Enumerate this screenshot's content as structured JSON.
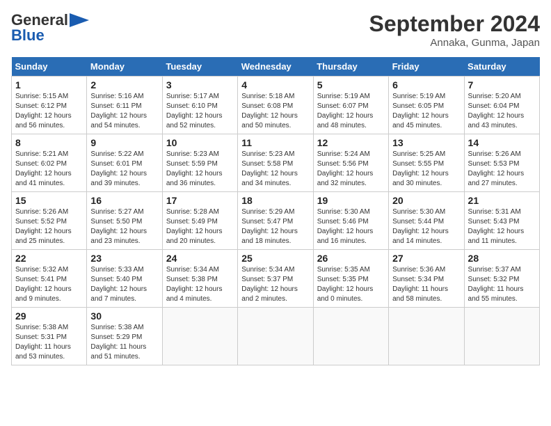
{
  "header": {
    "logo_line1": "General",
    "logo_line2": "Blue",
    "month_title": "September 2024",
    "location": "Annaka, Gunma, Japan"
  },
  "days_of_week": [
    "Sunday",
    "Monday",
    "Tuesday",
    "Wednesday",
    "Thursday",
    "Friday",
    "Saturday"
  ],
  "weeks": [
    [
      {
        "day": "1",
        "info": "Sunrise: 5:15 AM\nSunset: 6:12 PM\nDaylight: 12 hours\nand 56 minutes."
      },
      {
        "day": "2",
        "info": "Sunrise: 5:16 AM\nSunset: 6:11 PM\nDaylight: 12 hours\nand 54 minutes."
      },
      {
        "day": "3",
        "info": "Sunrise: 5:17 AM\nSunset: 6:10 PM\nDaylight: 12 hours\nand 52 minutes."
      },
      {
        "day": "4",
        "info": "Sunrise: 5:18 AM\nSunset: 6:08 PM\nDaylight: 12 hours\nand 50 minutes."
      },
      {
        "day": "5",
        "info": "Sunrise: 5:19 AM\nSunset: 6:07 PM\nDaylight: 12 hours\nand 48 minutes."
      },
      {
        "day": "6",
        "info": "Sunrise: 5:19 AM\nSunset: 6:05 PM\nDaylight: 12 hours\nand 45 minutes."
      },
      {
        "day": "7",
        "info": "Sunrise: 5:20 AM\nSunset: 6:04 PM\nDaylight: 12 hours\nand 43 minutes."
      }
    ],
    [
      {
        "day": "8",
        "info": "Sunrise: 5:21 AM\nSunset: 6:02 PM\nDaylight: 12 hours\nand 41 minutes."
      },
      {
        "day": "9",
        "info": "Sunrise: 5:22 AM\nSunset: 6:01 PM\nDaylight: 12 hours\nand 39 minutes."
      },
      {
        "day": "10",
        "info": "Sunrise: 5:23 AM\nSunset: 5:59 PM\nDaylight: 12 hours\nand 36 minutes."
      },
      {
        "day": "11",
        "info": "Sunrise: 5:23 AM\nSunset: 5:58 PM\nDaylight: 12 hours\nand 34 minutes."
      },
      {
        "day": "12",
        "info": "Sunrise: 5:24 AM\nSunset: 5:56 PM\nDaylight: 12 hours\nand 32 minutes."
      },
      {
        "day": "13",
        "info": "Sunrise: 5:25 AM\nSunset: 5:55 PM\nDaylight: 12 hours\nand 30 minutes."
      },
      {
        "day": "14",
        "info": "Sunrise: 5:26 AM\nSunset: 5:53 PM\nDaylight: 12 hours\nand 27 minutes."
      }
    ],
    [
      {
        "day": "15",
        "info": "Sunrise: 5:26 AM\nSunset: 5:52 PM\nDaylight: 12 hours\nand 25 minutes."
      },
      {
        "day": "16",
        "info": "Sunrise: 5:27 AM\nSunset: 5:50 PM\nDaylight: 12 hours\nand 23 minutes."
      },
      {
        "day": "17",
        "info": "Sunrise: 5:28 AM\nSunset: 5:49 PM\nDaylight: 12 hours\nand 20 minutes."
      },
      {
        "day": "18",
        "info": "Sunrise: 5:29 AM\nSunset: 5:47 PM\nDaylight: 12 hours\nand 18 minutes."
      },
      {
        "day": "19",
        "info": "Sunrise: 5:30 AM\nSunset: 5:46 PM\nDaylight: 12 hours\nand 16 minutes."
      },
      {
        "day": "20",
        "info": "Sunrise: 5:30 AM\nSunset: 5:44 PM\nDaylight: 12 hours\nand 14 minutes."
      },
      {
        "day": "21",
        "info": "Sunrise: 5:31 AM\nSunset: 5:43 PM\nDaylight: 12 hours\nand 11 minutes."
      }
    ],
    [
      {
        "day": "22",
        "info": "Sunrise: 5:32 AM\nSunset: 5:41 PM\nDaylight: 12 hours\nand 9 minutes."
      },
      {
        "day": "23",
        "info": "Sunrise: 5:33 AM\nSunset: 5:40 PM\nDaylight: 12 hours\nand 7 minutes."
      },
      {
        "day": "24",
        "info": "Sunrise: 5:34 AM\nSunset: 5:38 PM\nDaylight: 12 hours\nand 4 minutes."
      },
      {
        "day": "25",
        "info": "Sunrise: 5:34 AM\nSunset: 5:37 PM\nDaylight: 12 hours\nand 2 minutes."
      },
      {
        "day": "26",
        "info": "Sunrise: 5:35 AM\nSunset: 5:35 PM\nDaylight: 12 hours\nand 0 minutes."
      },
      {
        "day": "27",
        "info": "Sunrise: 5:36 AM\nSunset: 5:34 PM\nDaylight: 11 hours\nand 58 minutes."
      },
      {
        "day": "28",
        "info": "Sunrise: 5:37 AM\nSunset: 5:32 PM\nDaylight: 11 hours\nand 55 minutes."
      }
    ],
    [
      {
        "day": "29",
        "info": "Sunrise: 5:38 AM\nSunset: 5:31 PM\nDaylight: 11 hours\nand 53 minutes."
      },
      {
        "day": "30",
        "info": "Sunrise: 5:38 AM\nSunset: 5:29 PM\nDaylight: 11 hours\nand 51 minutes."
      },
      {
        "day": "",
        "info": ""
      },
      {
        "day": "",
        "info": ""
      },
      {
        "day": "",
        "info": ""
      },
      {
        "day": "",
        "info": ""
      },
      {
        "day": "",
        "info": ""
      }
    ]
  ]
}
